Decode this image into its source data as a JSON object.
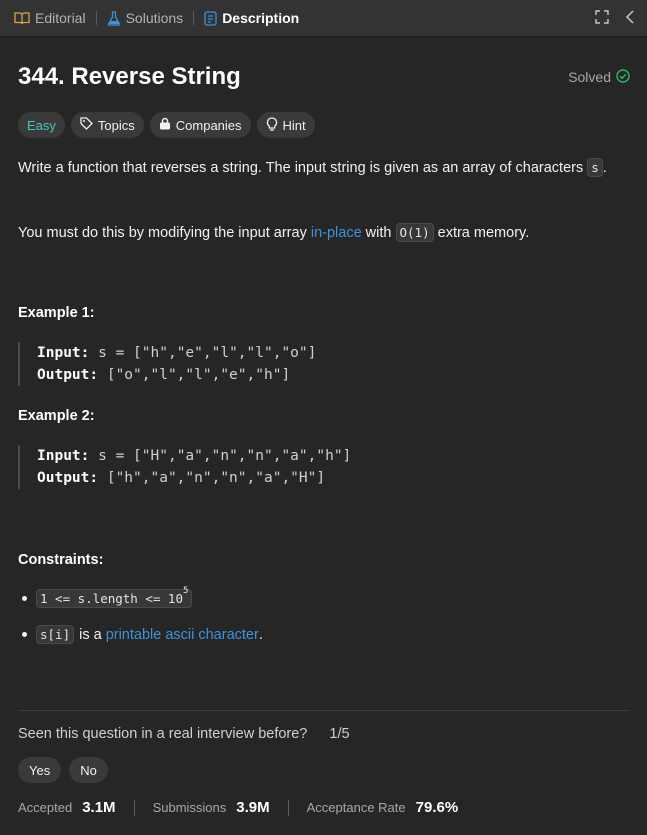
{
  "tabs": {
    "editorial": "Editorial",
    "solutions": "Solutions",
    "description": "Description"
  },
  "problem": {
    "title": "344. Reverse String",
    "status": "Solved",
    "difficulty": "Easy",
    "topics": "Topics",
    "companies": "Companies",
    "hint": "Hint"
  },
  "description": {
    "p1_text": "Write a function that reverses a string. The input string is given as an array of characters",
    "p1_code": "s",
    "p1_end": ".",
    "p2_pre": "You must do this by modifying the input array",
    "p2_link": "in-place",
    "p2_mid": "with",
    "p2_code": "O(1)",
    "p2_post": "extra memory."
  },
  "examples": [
    {
      "heading": "Example 1:",
      "input_label": "Input:",
      "input": "s = [\"h\",\"e\",\"l\",\"l\",\"o\"]",
      "output_label": "Output:",
      "output": "[\"o\",\"l\",\"l\",\"e\",\"h\"]"
    },
    {
      "heading": "Example 2:",
      "input_label": "Input:",
      "input": "s = [\"H\",\"a\",\"n\",\"n\",\"a\",\"h\"]",
      "output_label": "Output:",
      "output": "[\"h\",\"a\",\"n\",\"n\",\"a\",\"H\"]"
    }
  ],
  "constraints": {
    "heading": "Constraints:",
    "c1_code": "1 <= s.length <= 10",
    "c1_sup": "5",
    "c2_code": "s[i]",
    "c2_mid": "is a",
    "c2_link": "printable ascii character",
    "c2_end": "."
  },
  "interview": {
    "question": "Seen this question in a real interview before?",
    "count": "1/5",
    "yes": "Yes",
    "no": "No"
  },
  "stats": {
    "accepted_label": "Accepted",
    "accepted": "3.1M",
    "submissions_label": "Submissions",
    "submissions": "3.9M",
    "rate_label": "Acceptance Rate",
    "rate": "79.6%"
  },
  "colors": {
    "background": "#262626",
    "tabbar": "#333333",
    "easy": "#46c6c2",
    "solved": "#2cbb5d",
    "link": "#3c92dc"
  }
}
